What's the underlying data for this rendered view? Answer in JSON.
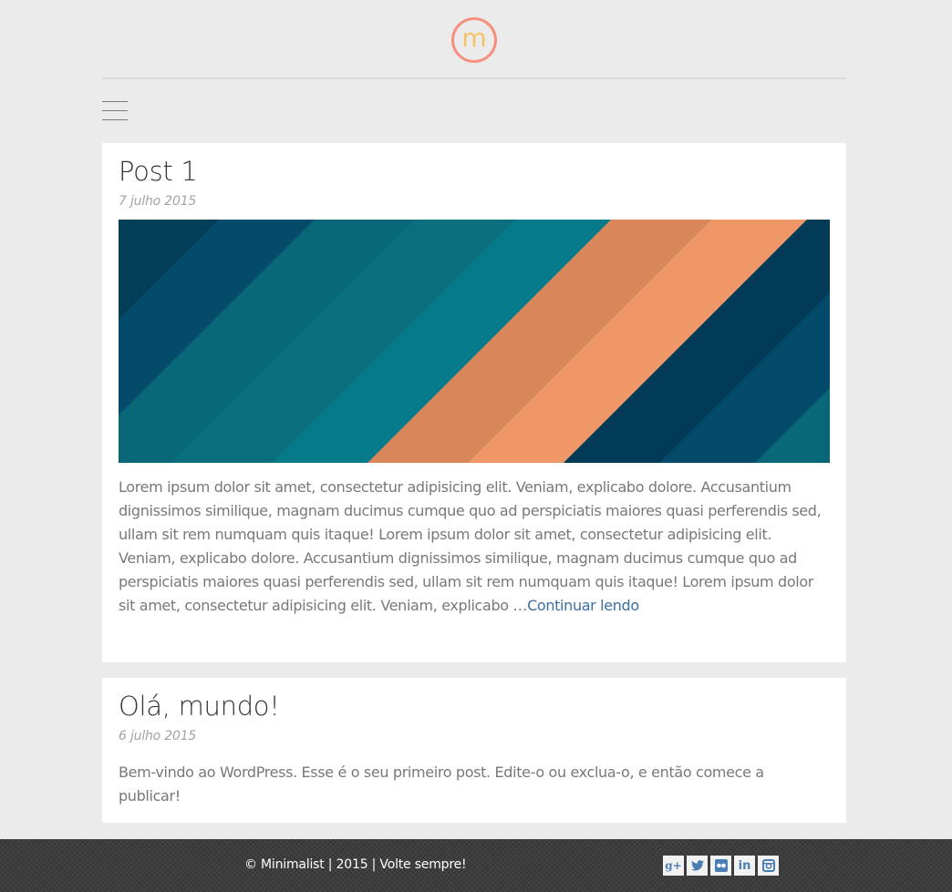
{
  "site": {
    "logo_letter": "m",
    "logo_color": "#f5c26b",
    "logo_ring_color": "#f6907e"
  },
  "menu": {
    "icon": "hamburger-menu-icon"
  },
  "posts": [
    {
      "title": "Post 1",
      "date": "7 julho 2015",
      "image": "diagonal-stripes-featured-image",
      "excerpt": "Lorem ipsum dolor sit amet, consectetur adipisicing elit. Veniam, explicabo dolore. Accusantium dignissimos similique, magnam ducimus cumque quo ad perspiciatis maiores quasi perferendis sed, ullam sit rem numquam quis itaque! Lorem ipsum dolor sit amet, consectetur adipisicing elit. Veniam, explicabo dolore. Accusantium dignissimos similique, magnam ducimus cumque quo ad perspiciatis maiores quasi perferendis sed, ullam sit rem numquam quis itaque! Lorem ipsum dolor sit amet, consectetur adipisicing elit. Veniam, explicabo …",
      "read_more": "Continuar lendo"
    },
    {
      "title": "Olá, mundo!",
      "date": "6 julho 2015",
      "excerpt": "Bem-vindo ao WordPress. Esse é o seu primeiro post. Edite-o ou exclua-o, e então comece a publicar!"
    }
  ],
  "footer": {
    "copyright": "© Minimalist | 2015 | Volte sempre!",
    "social": [
      {
        "name": "google-plus-icon",
        "glyph": "g+"
      },
      {
        "name": "twitter-icon",
        "glyph": ""
      },
      {
        "name": "flickr-icon",
        "glyph": ""
      },
      {
        "name": "linkedin-icon",
        "glyph": "in"
      },
      {
        "name": "instagram-icon",
        "glyph": ""
      }
    ]
  },
  "colors": {
    "link": "#3a6ea5",
    "background": "#ebebeb",
    "footer": "#3d3d3d"
  }
}
